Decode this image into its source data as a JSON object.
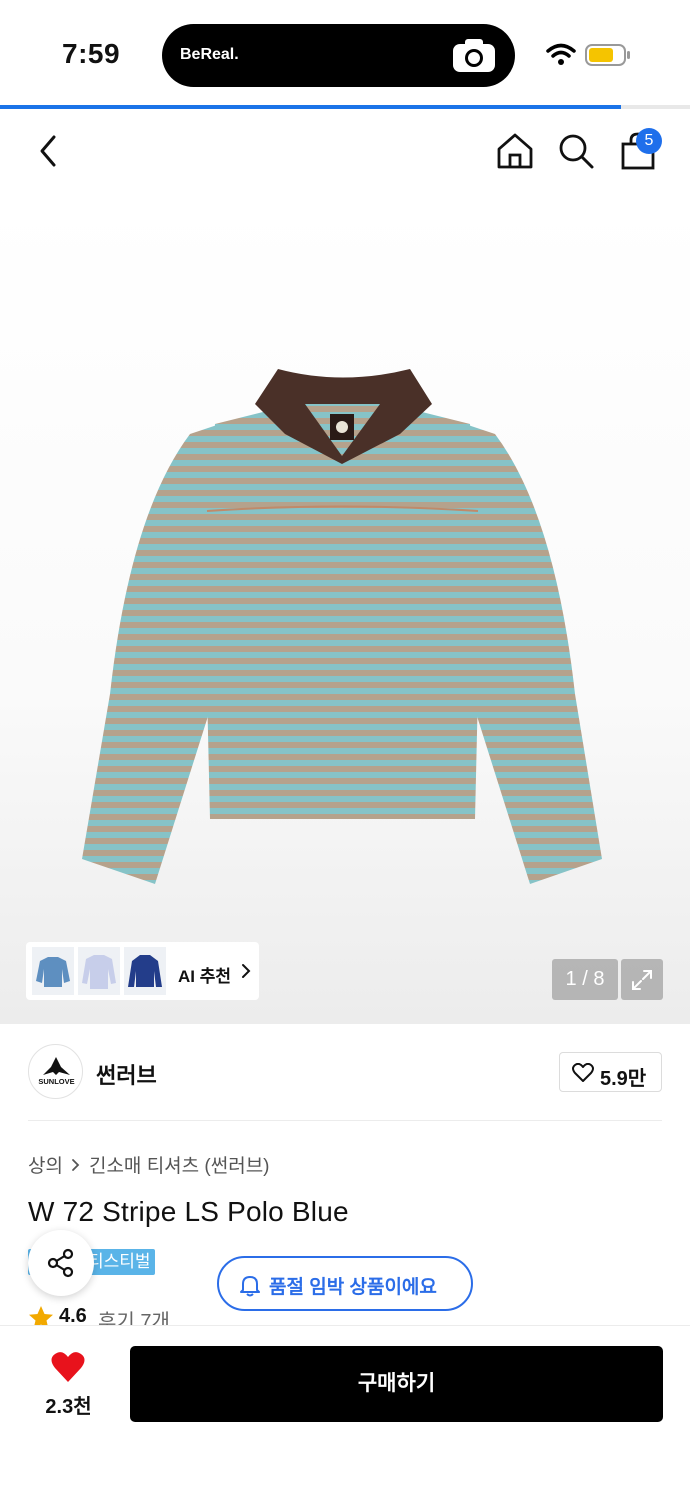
{
  "status_bar": {
    "time": "7:59",
    "island_label": "BeReal.",
    "icons": [
      "camera-icon",
      "wifi-icon",
      "battery-icon"
    ],
    "battery_color": "#f5c400"
  },
  "page_progress": 0.9,
  "header": {
    "icons": [
      "back-icon",
      "home-icon",
      "search-icon",
      "shopping-bag-icon"
    ],
    "cart_count": "5",
    "accent_color": "#1f6feb"
  },
  "hero": {
    "ai_recommend_label": "AI 추천",
    "page_indicator": "1 / 8"
  },
  "brand": {
    "logo_text": "SUNLOVE",
    "name": "썬러브",
    "likes": "5.9만"
  },
  "breadcrumb": {
    "category": "상의",
    "subcategory": "긴소매 티셔츠 (썬러브)"
  },
  "product": {
    "title": "W 72 Stripe LS Polo Blue",
    "badge_visible_text": "티스티벌",
    "soldout_notice": "품절 임박 상품이에요",
    "rating": "4.6",
    "reviews": "후기 7개"
  },
  "bottom_bar": {
    "wish_count": "2.3천",
    "buy_label": "구매하기"
  }
}
